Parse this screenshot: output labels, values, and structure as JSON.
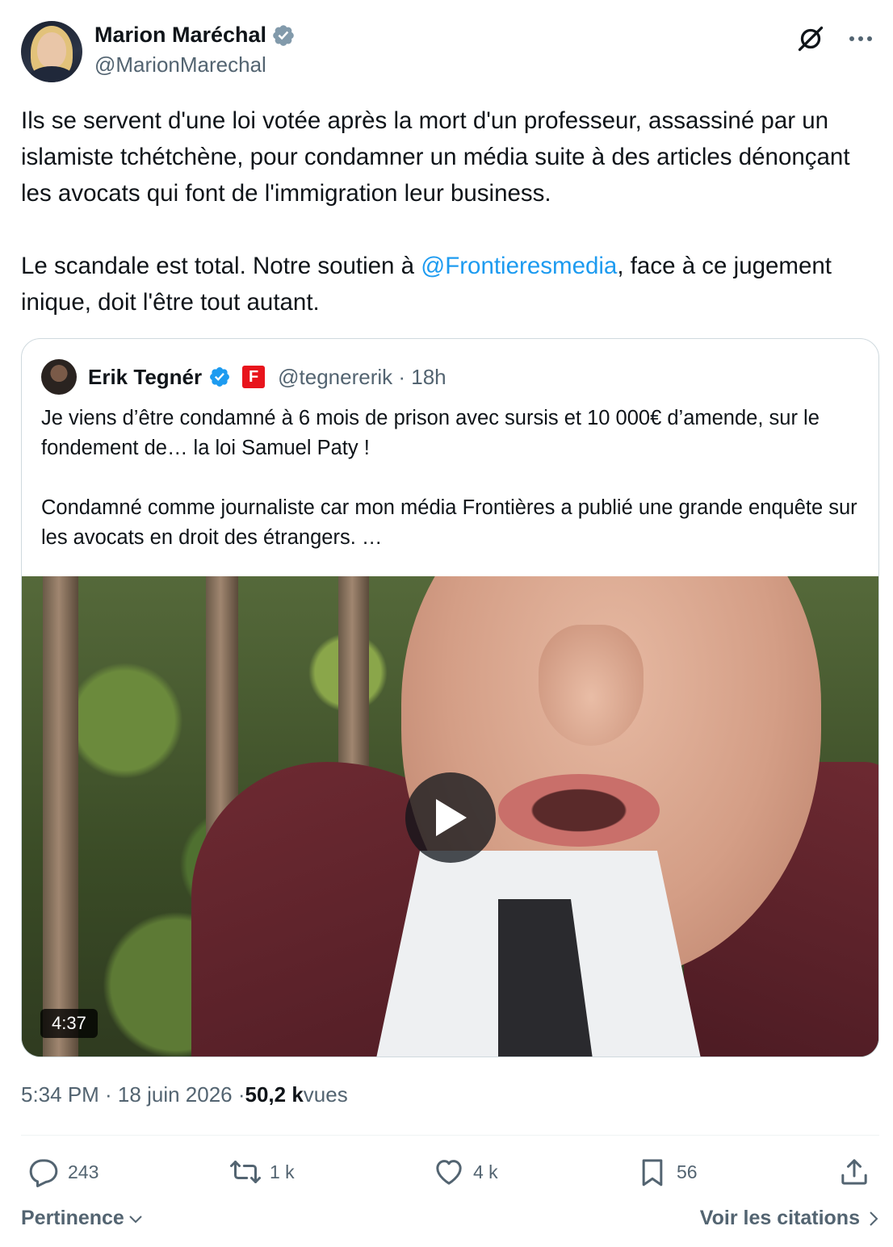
{
  "author": {
    "display_name": "Marion Maréchal",
    "handle": "@MarionMarechal"
  },
  "tweet": {
    "line1": "Ils se servent d'une loi votée après la mort d'un professeur, assassiné par un islamiste tchétchène, pour condamner un média suite à des articles dénonçant les avocats qui font de l'immigration leur business.",
    "line2_pre": "Le scandale est total. Notre soutien à ",
    "mention": "@Frontieresmedia",
    "line2_post": ", face à ce jugement inique, doit l'être tout autant."
  },
  "quote": {
    "display_name": "Erik Tegnér",
    "badge_letter": "F",
    "handle_time": "@tegnererik · 18h",
    "para1": "Je viens d’être condamné à 6 mois de prison avec sursis et 10 000€ d’amende, sur le fondement de… la loi Samuel Paty !",
    "para2": "Condamné comme journaliste car mon média Frontières a publié une grande enquête sur les avocats en droit des étrangers. …",
    "video_duration": "4:37"
  },
  "meta": {
    "time_date": "5:34 PM · 18 juin 2026 · ",
    "views_count": "50,2 k",
    "views_label": " vues"
  },
  "actions": {
    "replies": "243",
    "reposts": "1 k",
    "likes": "4 k",
    "bookmarks": "56"
  },
  "footer": {
    "sort_label": "Pertinence",
    "quotes_link": "Voir les citations"
  },
  "colors": {
    "accent": "#1d9bf0",
    "text": "#0f1419",
    "muted": "#536471",
    "verified_gray": "#829aab",
    "verified_blue": "#1d9bf0",
    "frontieres_red": "#e8141c"
  }
}
